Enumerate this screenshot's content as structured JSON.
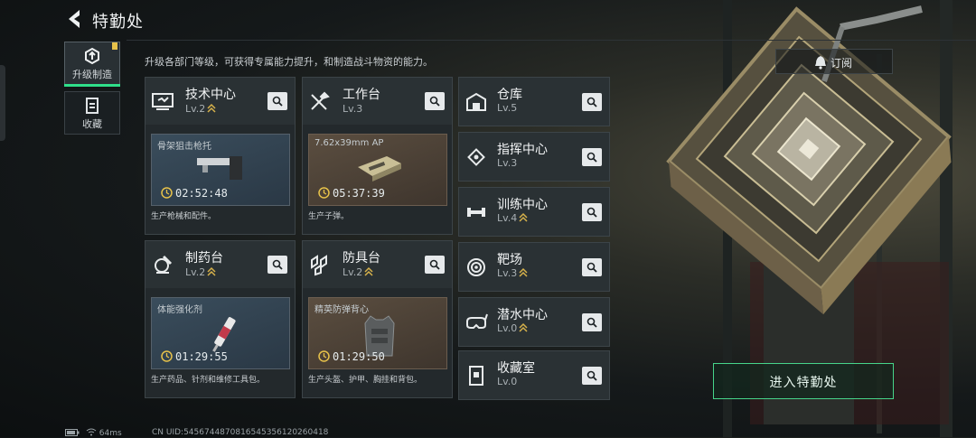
{
  "header": {
    "title": "特勤处"
  },
  "subtitle": "升级各部门等级，可获得专属能力提升，和制造战斗物资的能力。",
  "nav": [
    {
      "label": "升级制造",
      "icon": "upgrade-build-icon",
      "selected": true
    },
    {
      "label": "收藏",
      "icon": "collection-icon",
      "selected": false
    }
  ],
  "cards": [
    {
      "name": "技术中心",
      "level": "Lv.2",
      "product": "骨架狙击枪托",
      "timer": "02:52:48",
      "desc": "生产枪械和配件。",
      "icon": "tech-center-icon"
    },
    {
      "name": "工作台",
      "level": "Lv.3",
      "product": "7.62x39mm AP",
      "timer": "05:37:39",
      "desc": "生产子弹。",
      "icon": "workbench-icon"
    },
    {
      "name": "制药台",
      "level": "Lv.2",
      "product": "体能强化剂",
      "timer": "01:29:55",
      "desc": "生产药品、针剂和维修工具包。",
      "icon": "pharmacy-icon"
    },
    {
      "name": "防具台",
      "level": "Lv.2",
      "product": "精英防弹背心",
      "timer": "01:29:50",
      "desc": "生产头盔、护甲、胸挂和背包。",
      "icon": "armor-bench-icon"
    }
  ],
  "facilities": [
    {
      "name": "仓库",
      "level": "Lv.5",
      "icon": "warehouse-icon"
    },
    {
      "name": "指挥中心",
      "level": "Lv.3",
      "icon": "command-center-icon"
    },
    {
      "name": "训练中心",
      "level": "Lv.4",
      "icon": "training-center-icon"
    },
    {
      "name": "靶场",
      "level": "Lv.3",
      "icon": "shooting-range-icon"
    },
    {
      "name": "潜水中心",
      "level": "Lv.0",
      "icon": "diving-center-icon"
    },
    {
      "name": "收藏室",
      "level": "Lv.0",
      "icon": "collection-room-icon"
    }
  ],
  "subscribe_label": "订阅",
  "enter_label": "进入特勤处",
  "footer": {
    "ping": "64ms",
    "uid": "CN UID:5456744870816545356120260418"
  },
  "colors": {
    "accent": "#2fe08a",
    "gold": "#e7c24a"
  }
}
